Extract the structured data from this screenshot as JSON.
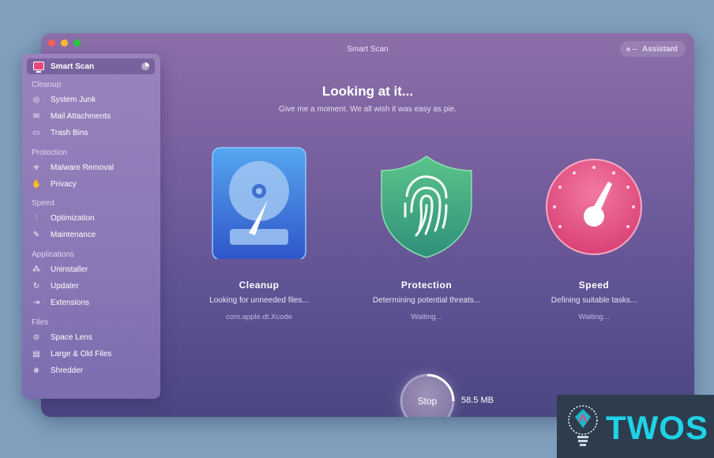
{
  "window": {
    "title": "Smart Scan",
    "assistant_label": "Assistant",
    "traffic_colors": [
      "#ff5f57",
      "#febc2e",
      "#28c840"
    ]
  },
  "sidebar": {
    "selected": {
      "label": "Smart Scan",
      "icon": "monitor-icon"
    },
    "sections": [
      {
        "title": "Cleanup",
        "items": [
          {
            "label": "System Junk",
            "icon": "disk-icon"
          },
          {
            "label": "Mail Attachments",
            "icon": "mail-icon"
          },
          {
            "label": "Trash Bins",
            "icon": "trash-icon"
          }
        ]
      },
      {
        "title": "Protection",
        "items": [
          {
            "label": "Malware Removal",
            "icon": "biohazard-icon"
          },
          {
            "label": "Privacy",
            "icon": "hand-icon"
          }
        ]
      },
      {
        "title": "Speed",
        "items": [
          {
            "label": "Optimization",
            "icon": "sliders-icon"
          },
          {
            "label": "Maintenance",
            "icon": "wrench-icon"
          }
        ]
      },
      {
        "title": "Applications",
        "items": [
          {
            "label": "Uninstaller",
            "icon": "apps-icon"
          },
          {
            "label": "Updater",
            "icon": "update-icon"
          },
          {
            "label": "Extensions",
            "icon": "extensions-icon"
          }
        ]
      },
      {
        "title": "Files",
        "items": [
          {
            "label": "Space Lens",
            "icon": "lens-icon"
          },
          {
            "label": "Large & Old Files",
            "icon": "folder-icon"
          },
          {
            "label": "Shredder",
            "icon": "shredder-icon"
          }
        ]
      }
    ]
  },
  "main": {
    "heading": "Looking at it...",
    "subheading": "Give me a moment. We all wish it was easy as pie.",
    "modules": [
      {
        "name": "Cleanup",
        "status": "Looking for unneeded files...",
        "detail": "com.apple.dt.Xcode",
        "icon": "hard-drive-icon"
      },
      {
        "name": "Protection",
        "status": "Determining potential threats...",
        "detail": "Waiting...",
        "icon": "fingerprint-shield-icon"
      },
      {
        "name": "Speed",
        "status": "Defining suitable tasks...",
        "detail": "Waiting...",
        "icon": "speedometer-icon"
      }
    ],
    "stop_label": "Stop",
    "scanned_size": "58.5 MB"
  },
  "watermark": {
    "text": "TWOS"
  },
  "colors": {
    "accent_pink": "#e9477a",
    "shield_green": "#3fae7a",
    "drive_blue": "#3a78d6"
  }
}
